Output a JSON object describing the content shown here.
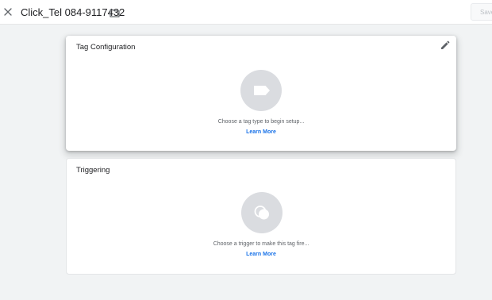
{
  "header": {
    "tag_name": "Click_Tel 084-9117432",
    "save_label": "Save",
    "icons": {
      "close": "close-icon",
      "folder": "folder-icon"
    }
  },
  "tag_config": {
    "title": "Tag Configuration",
    "hint": "Choose a tag type to begin setup...",
    "learn_more": "Learn More",
    "icons": {
      "edit": "pencil-icon",
      "placeholder": "tag-icon"
    }
  },
  "triggering": {
    "title": "Triggering",
    "hint": "Choose a trigger to make this tag fire...",
    "learn_more": "Learn More",
    "icons": {
      "placeholder": "trigger-icon"
    }
  },
  "colors": {
    "accent": "#1a73e8",
    "background": "#f1f3f4",
    "placeholder_circle": "#dadce0"
  }
}
